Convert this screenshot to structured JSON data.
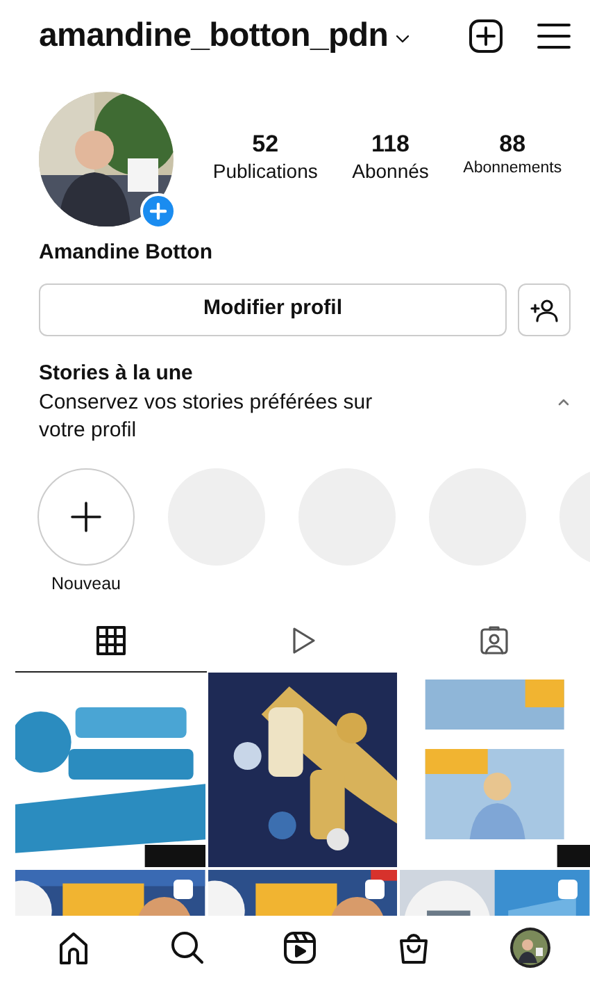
{
  "header": {
    "username": "amandine_botton_pdn"
  },
  "profile": {
    "name": "Amandine Botton",
    "stats": [
      {
        "value": "52",
        "label": "Publications"
      },
      {
        "value": "118",
        "label": "Abonnés"
      },
      {
        "value": "88",
        "label": "Abonnements"
      }
    ]
  },
  "actions": {
    "edit_button": "Modifier profil"
  },
  "highlights": {
    "title": "Stories à la une",
    "subtitle": "Conservez vos stories préférées sur votre profil",
    "expanded": true,
    "new_label": "Nouveau"
  },
  "tabs": [
    {
      "kind": "grid",
      "selected": true
    },
    {
      "kind": "reels",
      "selected": false
    },
    {
      "kind": "tagged",
      "selected": false
    }
  ],
  "posts": [
    {
      "kind": "picture",
      "carousel": false
    },
    {
      "kind": "picture",
      "carousel": false
    },
    {
      "kind": "picture",
      "carousel": false
    },
    {
      "kind": "picture",
      "carousel": true
    },
    {
      "kind": "picture",
      "carousel": true
    },
    {
      "kind": "picture",
      "carousel": true
    }
  ],
  "bottom_nav": [
    {
      "kind": "home"
    },
    {
      "kind": "search"
    },
    {
      "kind": "reels"
    },
    {
      "kind": "shop"
    },
    {
      "kind": "profile"
    }
  ]
}
